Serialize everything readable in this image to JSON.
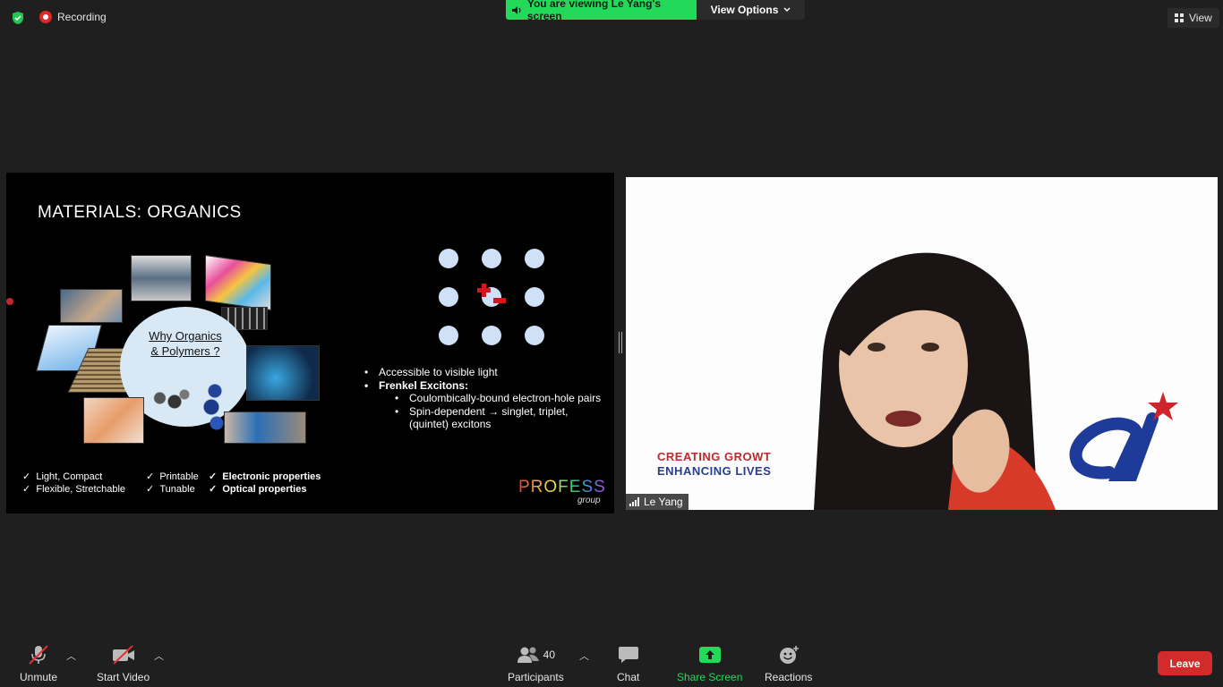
{
  "top_bar": {
    "recording_label": "Recording",
    "viewing_banner": "You are viewing Le Yang's screen",
    "view_options_label": "View Options",
    "view_label": "View"
  },
  "slide": {
    "title": "MATERIALS: ORGANICS",
    "center_text_line1": "Why Organics",
    "center_text_line2": "& Polymers ?",
    "checks_col1": [
      "Light, Compact",
      "Flexible, Stretchable"
    ],
    "checks_col2": [
      "Printable",
      "Tunable"
    ],
    "checks_col3": [
      "Electronic properties",
      "Optical properties"
    ],
    "bullets": {
      "b1": "Accessible to visible light",
      "b2": "Frenkel Excitons:",
      "sub1": "Coulombically-bound electron-hole pairs",
      "sub2": "Spin-dependent → singlet, triplet, (quintet) excitons"
    },
    "brand": "PROFESS",
    "brand_sub": "group"
  },
  "video": {
    "participant_name": "Le Yang",
    "banner_line1": "CREATING GROWT",
    "banner_line2": "ENHANCING LIVES"
  },
  "toolbar": {
    "unmute_label": "Unmute",
    "start_video_label": "Start Video",
    "participants_label": "Participants",
    "participants_count": "40",
    "chat_label": "Chat",
    "share_screen_label": "Share Screen",
    "reactions_label": "Reactions",
    "leave_label": "Leave"
  },
  "colors": {
    "banner_green": "#23d959",
    "leave_red": "#d22b2b",
    "share_green": "#23d959"
  }
}
